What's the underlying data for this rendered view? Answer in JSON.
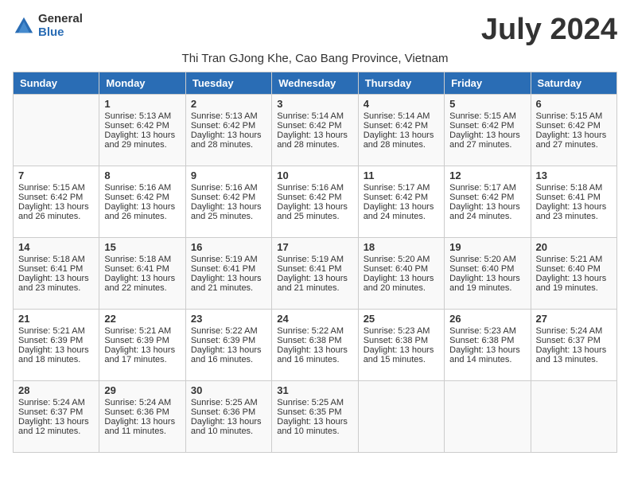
{
  "header": {
    "logo_general": "General",
    "logo_blue": "Blue",
    "month_title": "July 2024",
    "subtitle": "Thi Tran GJong Khe, Cao Bang Province, Vietnam"
  },
  "days_of_week": [
    "Sunday",
    "Monday",
    "Tuesday",
    "Wednesday",
    "Thursday",
    "Friday",
    "Saturday"
  ],
  "weeks": [
    [
      {
        "day": "",
        "sunrise": "",
        "sunset": "",
        "daylight": ""
      },
      {
        "day": "1",
        "sunrise": "Sunrise: 5:13 AM",
        "sunset": "Sunset: 6:42 PM",
        "daylight": "Daylight: 13 hours and 29 minutes."
      },
      {
        "day": "2",
        "sunrise": "Sunrise: 5:13 AM",
        "sunset": "Sunset: 6:42 PM",
        "daylight": "Daylight: 13 hours and 28 minutes."
      },
      {
        "day": "3",
        "sunrise": "Sunrise: 5:14 AM",
        "sunset": "Sunset: 6:42 PM",
        "daylight": "Daylight: 13 hours and 28 minutes."
      },
      {
        "day": "4",
        "sunrise": "Sunrise: 5:14 AM",
        "sunset": "Sunset: 6:42 PM",
        "daylight": "Daylight: 13 hours and 28 minutes."
      },
      {
        "day": "5",
        "sunrise": "Sunrise: 5:15 AM",
        "sunset": "Sunset: 6:42 PM",
        "daylight": "Daylight: 13 hours and 27 minutes."
      },
      {
        "day": "6",
        "sunrise": "Sunrise: 5:15 AM",
        "sunset": "Sunset: 6:42 PM",
        "daylight": "Daylight: 13 hours and 27 minutes."
      }
    ],
    [
      {
        "day": "7",
        "sunrise": "Sunrise: 5:15 AM",
        "sunset": "Sunset: 6:42 PM",
        "daylight": "Daylight: 13 hours and 26 minutes."
      },
      {
        "day": "8",
        "sunrise": "Sunrise: 5:16 AM",
        "sunset": "Sunset: 6:42 PM",
        "daylight": "Daylight: 13 hours and 26 minutes."
      },
      {
        "day": "9",
        "sunrise": "Sunrise: 5:16 AM",
        "sunset": "Sunset: 6:42 PM",
        "daylight": "Daylight: 13 hours and 25 minutes."
      },
      {
        "day": "10",
        "sunrise": "Sunrise: 5:16 AM",
        "sunset": "Sunset: 6:42 PM",
        "daylight": "Daylight: 13 hours and 25 minutes."
      },
      {
        "day": "11",
        "sunrise": "Sunrise: 5:17 AM",
        "sunset": "Sunset: 6:42 PM",
        "daylight": "Daylight: 13 hours and 24 minutes."
      },
      {
        "day": "12",
        "sunrise": "Sunrise: 5:17 AM",
        "sunset": "Sunset: 6:42 PM",
        "daylight": "Daylight: 13 hours and 24 minutes."
      },
      {
        "day": "13",
        "sunrise": "Sunrise: 5:18 AM",
        "sunset": "Sunset: 6:41 PM",
        "daylight": "Daylight: 13 hours and 23 minutes."
      }
    ],
    [
      {
        "day": "14",
        "sunrise": "Sunrise: 5:18 AM",
        "sunset": "Sunset: 6:41 PM",
        "daylight": "Daylight: 13 hours and 23 minutes."
      },
      {
        "day": "15",
        "sunrise": "Sunrise: 5:18 AM",
        "sunset": "Sunset: 6:41 PM",
        "daylight": "Daylight: 13 hours and 22 minutes."
      },
      {
        "day": "16",
        "sunrise": "Sunrise: 5:19 AM",
        "sunset": "Sunset: 6:41 PM",
        "daylight": "Daylight: 13 hours and 21 minutes."
      },
      {
        "day": "17",
        "sunrise": "Sunrise: 5:19 AM",
        "sunset": "Sunset: 6:41 PM",
        "daylight": "Daylight: 13 hours and 21 minutes."
      },
      {
        "day": "18",
        "sunrise": "Sunrise: 5:20 AM",
        "sunset": "Sunset: 6:40 PM",
        "daylight": "Daylight: 13 hours and 20 minutes."
      },
      {
        "day": "19",
        "sunrise": "Sunrise: 5:20 AM",
        "sunset": "Sunset: 6:40 PM",
        "daylight": "Daylight: 13 hours and 19 minutes."
      },
      {
        "day": "20",
        "sunrise": "Sunrise: 5:21 AM",
        "sunset": "Sunset: 6:40 PM",
        "daylight": "Daylight: 13 hours and 19 minutes."
      }
    ],
    [
      {
        "day": "21",
        "sunrise": "Sunrise: 5:21 AM",
        "sunset": "Sunset: 6:39 PM",
        "daylight": "Daylight: 13 hours and 18 minutes."
      },
      {
        "day": "22",
        "sunrise": "Sunrise: 5:21 AM",
        "sunset": "Sunset: 6:39 PM",
        "daylight": "Daylight: 13 hours and 17 minutes."
      },
      {
        "day": "23",
        "sunrise": "Sunrise: 5:22 AM",
        "sunset": "Sunset: 6:39 PM",
        "daylight": "Daylight: 13 hours and 16 minutes."
      },
      {
        "day": "24",
        "sunrise": "Sunrise: 5:22 AM",
        "sunset": "Sunset: 6:38 PM",
        "daylight": "Daylight: 13 hours and 16 minutes."
      },
      {
        "day": "25",
        "sunrise": "Sunrise: 5:23 AM",
        "sunset": "Sunset: 6:38 PM",
        "daylight": "Daylight: 13 hours and 15 minutes."
      },
      {
        "day": "26",
        "sunrise": "Sunrise: 5:23 AM",
        "sunset": "Sunset: 6:38 PM",
        "daylight": "Daylight: 13 hours and 14 minutes."
      },
      {
        "day": "27",
        "sunrise": "Sunrise: 5:24 AM",
        "sunset": "Sunset: 6:37 PM",
        "daylight": "Daylight: 13 hours and 13 minutes."
      }
    ],
    [
      {
        "day": "28",
        "sunrise": "Sunrise: 5:24 AM",
        "sunset": "Sunset: 6:37 PM",
        "daylight": "Daylight: 13 hours and 12 minutes."
      },
      {
        "day": "29",
        "sunrise": "Sunrise: 5:24 AM",
        "sunset": "Sunset: 6:36 PM",
        "daylight": "Daylight: 13 hours and 11 minutes."
      },
      {
        "day": "30",
        "sunrise": "Sunrise: 5:25 AM",
        "sunset": "Sunset: 6:36 PM",
        "daylight": "Daylight: 13 hours and 10 minutes."
      },
      {
        "day": "31",
        "sunrise": "Sunrise: 5:25 AM",
        "sunset": "Sunset: 6:35 PM",
        "daylight": "Daylight: 13 hours and 10 minutes."
      },
      {
        "day": "",
        "sunrise": "",
        "sunset": "",
        "daylight": ""
      },
      {
        "day": "",
        "sunrise": "",
        "sunset": "",
        "daylight": ""
      },
      {
        "day": "",
        "sunrise": "",
        "sunset": "",
        "daylight": ""
      }
    ]
  ]
}
